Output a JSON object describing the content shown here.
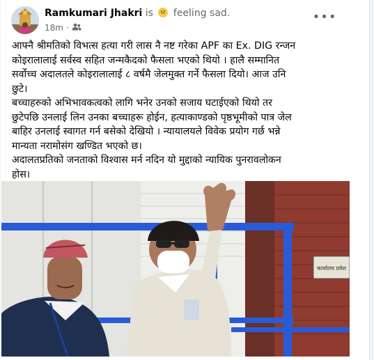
{
  "post": {
    "author_name": "Ramkumari Jhakri",
    "feeling_prefix": "is",
    "feeling_emoji": "sad-face-icon",
    "feeling_text": "feeling sad.",
    "time": "18m",
    "separator": "·",
    "audience_icon": "friends-icon",
    "more_icon": "more-options-icon",
    "more_label": "•••",
    "paragraphs": [
      "आफ्नै श्रीमतिको विभत्स हत्या गरी लास नै नष्ट गरेका APF का Ex. DIG रन्जन\nकोइरालालाई सर्वस्व सहित जन्मकैदको फैसला भएको थियो । हालै सम्मानित\nसर्वोच्च अदालतले कोइरालालाई ८ वर्षमै जेलमुक्त गर्ने फैसला दियो। आज उनि\nछुटे।",
      "बच्चाहरुको अभिभावकत्वको लागि भनेर उनको सजाय घटाईएको थियो तर\nछुटेपछि उनलाई लिन उनका बच्चाहरू होईन, हत्याकाण्डको पृष्ठभूमीको पात्र जेल\nबाहिर उनलाई स्वागत गर्न बसेको देखियो । न्यायालयले विवेक प्रयोग गर्छ भन्ने\nमान्यता नरामोसंग खण्डित भएको छ।",
      "अदालतप्रतिको जनताको विश्वास मर्न नदिन यो मुद्दाको न्यायिक पुनरावलोकन\nहोस।"
    ],
    "photo": {
      "sign_text": "कार्यालय प्रवेश",
      "colors": {
        "railing": "#2a5bd6",
        "brick": "#8f3b30",
        "wall": "#d7d6d1"
      }
    }
  }
}
